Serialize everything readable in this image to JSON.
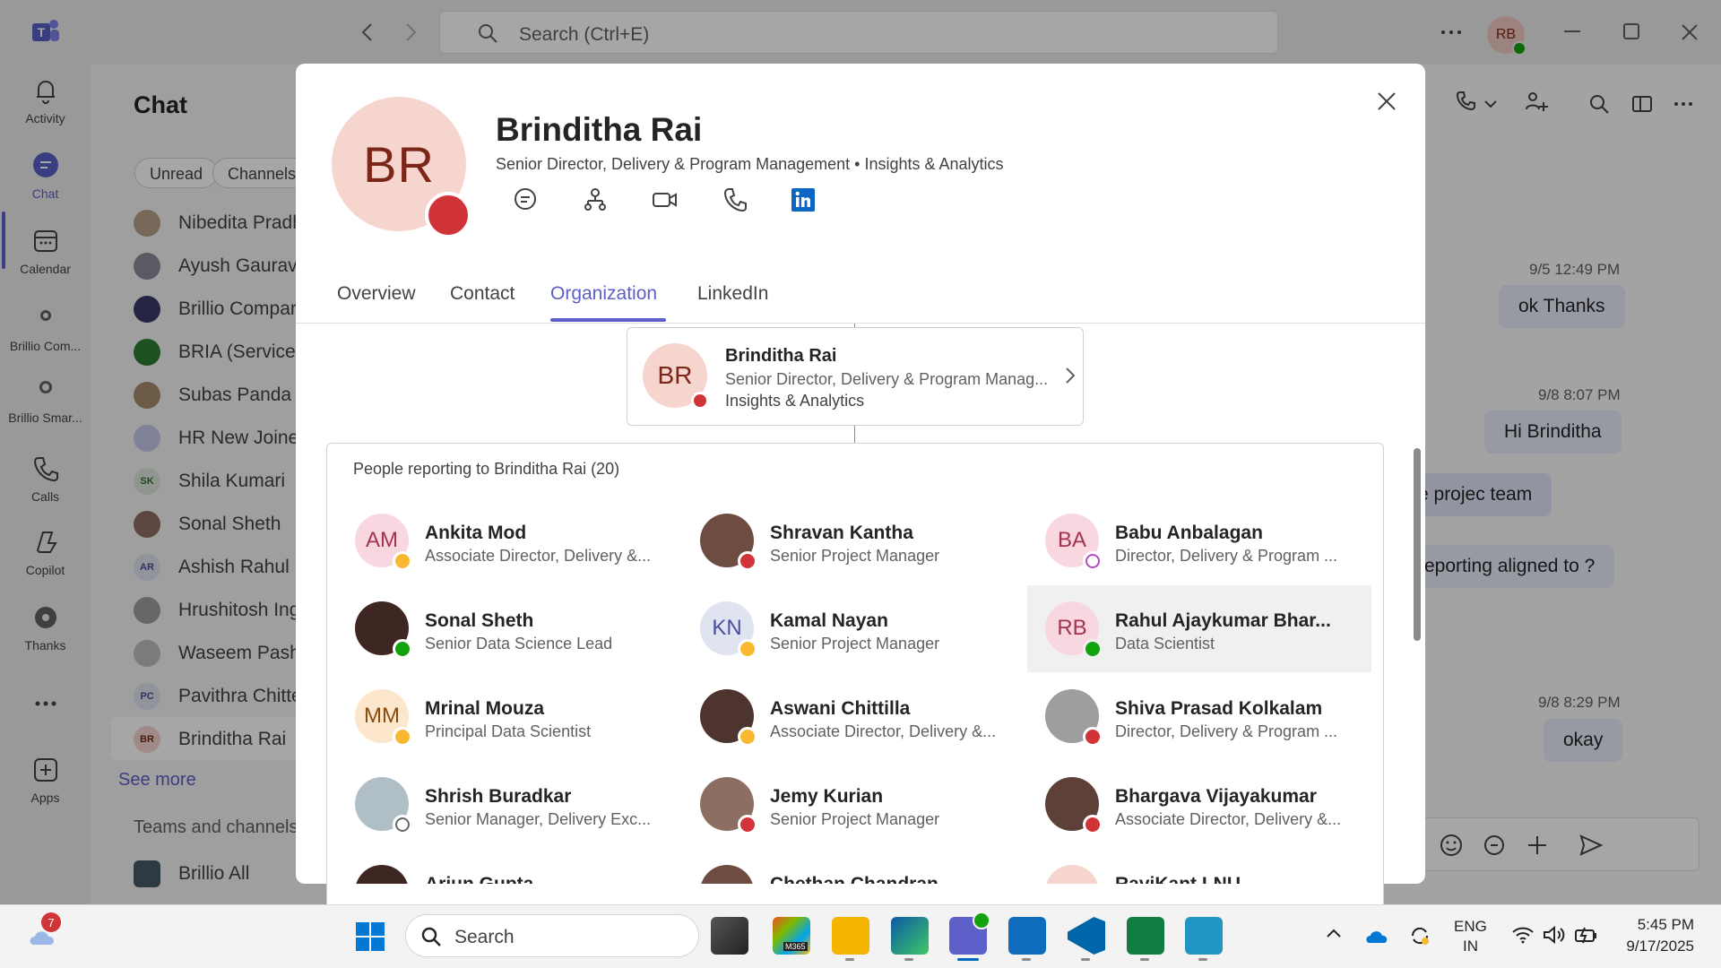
{
  "titlebar": {
    "search_placeholder": "Search (Ctrl+E)",
    "user_initials": "RB"
  },
  "rail": {
    "items": [
      {
        "label": "Activity",
        "icon": "bell-icon"
      },
      {
        "label": "Chat",
        "icon": "chat-icon"
      },
      {
        "label": "Calendar",
        "icon": "calendar-icon"
      },
      {
        "label": "Brillio Com...",
        "icon": "brillio-icon"
      },
      {
        "label": "Brillio Smar...",
        "icon": "brillio-smart-icon"
      },
      {
        "label": "Calls",
        "icon": "phone-icon"
      },
      {
        "label": "Copilot",
        "icon": "copilot-icon"
      },
      {
        "label": "Thanks",
        "icon": "gear-badge-icon"
      },
      {
        "label": "Apps",
        "icon": "apps-icon"
      }
    ]
  },
  "chatlist": {
    "title": "Chat",
    "filters": [
      "Unread",
      "Channels"
    ],
    "items": [
      {
        "name": "Nibedita Pradh",
        "initials": ""
      },
      {
        "name": "Ayush Gaurav",
        "initials": ""
      },
      {
        "name": "Brillio Compar",
        "initials": ""
      },
      {
        "name": "BRIA (ServiceN",
        "initials": ""
      },
      {
        "name": "Subas Panda",
        "initials": ""
      },
      {
        "name": "HR New Joiner",
        "initials": ""
      },
      {
        "name": "Shila Kumari",
        "initials": "SK"
      },
      {
        "name": "Sonal Sheth",
        "initials": ""
      },
      {
        "name": "Ashish Rahul",
        "initials": "AR"
      },
      {
        "name": "Hrushitosh Ing",
        "initials": ""
      },
      {
        "name": "Waseem Pasha",
        "initials": ""
      },
      {
        "name": "Pavithra Chitte",
        "initials": "PC"
      },
      {
        "name": "Brinditha Rai",
        "initials": "BR"
      }
    ],
    "see_more": "See more",
    "teams_header": "Teams and channels",
    "team": "Brillio All"
  },
  "conversation": {
    "messages": [
      {
        "time": "9/5 12:49 PM",
        "text": "ok Thanks"
      },
      {
        "time": "9/8 8:07 PM",
        "text": "Hi Brinditha"
      },
      {
        "time": "",
        "text": "e projec team"
      },
      {
        "time": "",
        "text": "reporting aligned to ?"
      },
      {
        "time": "9/8 8:29 PM",
        "text": "okay"
      }
    ]
  },
  "profile": {
    "initials": "BR",
    "name": "Brinditha Rai",
    "title": "Senior Director, Delivery & Program Management • Insights & Analytics",
    "actions": [
      "chat-icon",
      "org-chart-icon",
      "video-icon",
      "phone-icon",
      "linkedin-icon"
    ],
    "tabs": [
      "Overview",
      "Contact",
      "Organization",
      "LinkedIn"
    ],
    "active_tab": "Organization",
    "manager_card": {
      "initials": "BR",
      "name": "Brinditha Rai",
      "title": "Senior Director, Delivery & Program Manag...",
      "dept": "Insights & Analytics"
    },
    "reports_title": "People reporting to Brinditha Rai (20)",
    "reports": [
      {
        "name": "Ankita Mod",
        "title": "Associate Director, Delivery &...",
        "initials": "AM",
        "status": "away"
      },
      {
        "name": "Shravan Kantha",
        "title": "Senior Project Manager",
        "initials": "",
        "status": "busy"
      },
      {
        "name": "Babu Anbalagan",
        "title": "Director, Delivery & Program ...",
        "initials": "BA",
        "status": "ooo"
      },
      {
        "name": "Sonal Sheth",
        "title": "Senior Data Science Lead",
        "initials": "",
        "status": "available"
      },
      {
        "name": "Kamal Nayan",
        "title": "Senior Project Manager",
        "initials": "KN",
        "status": "away"
      },
      {
        "name": "Rahul Ajaykumar Bhar...",
        "title": "Data Scientist",
        "initials": "RB",
        "status": "available"
      },
      {
        "name": "Mrinal Mouza",
        "title": "Principal Data Scientist",
        "initials": "MM",
        "status": "away"
      },
      {
        "name": "Aswani Chittilla",
        "title": "Associate Director, Delivery &...",
        "initials": "",
        "status": "away"
      },
      {
        "name": "Shiva Prasad Kolkalam",
        "title": "Director, Delivery & Program ...",
        "initials": "",
        "status": "dnd"
      },
      {
        "name": "Shrish Buradkar",
        "title": "Senior Manager, Delivery Exc...",
        "initials": "",
        "status": "offline"
      },
      {
        "name": "Jemy Kurian",
        "title": "Senior Project Manager",
        "initials": "",
        "status": "busy"
      },
      {
        "name": "Bhargava Vijayakumar",
        "title": "Associate Director, Delivery &...",
        "initials": "",
        "status": "busy"
      },
      {
        "name": "Arjun Gupta",
        "title": "",
        "initials": "",
        "status": ""
      },
      {
        "name": "Chethan Chandran",
        "title": "",
        "initials": "",
        "status": ""
      },
      {
        "name": "RaviKant LNU",
        "title": "",
        "initials": "",
        "status": ""
      }
    ]
  },
  "taskbar": {
    "search_placeholder": "Search",
    "weather_badge": "7",
    "lang": "ENG",
    "region": "IN",
    "time": "5:45 PM",
    "date": "9/17/2025",
    "m365_label": "M365"
  },
  "colors": {
    "accent": "#5b5fc7",
    "busy": "#d13438",
    "away": "#f8b82f",
    "available": "#13a10e"
  }
}
